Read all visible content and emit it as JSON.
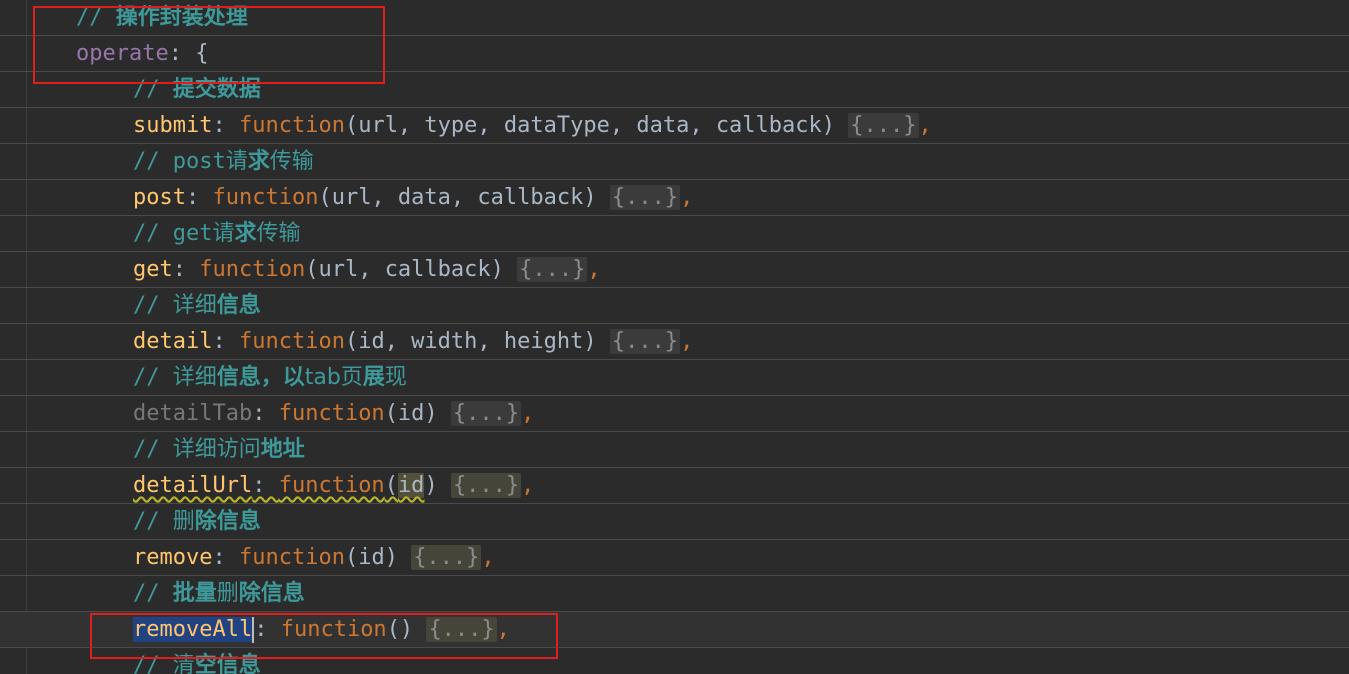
{
  "lines": [
    {
      "comment_slashes": "//",
      "comment_text": "操作封装处理"
    },
    {
      "prop": "operate",
      "rest": ": {"
    },
    {
      "comment_slashes": "//",
      "comment_text": "提交数据"
    },
    {
      "prop": "submit",
      "kw": "function",
      "params": "(url, type, dataType, data, callback)",
      "fold": "{...}"
    },
    {
      "comment_slashes": "//",
      "comment_text_a": "post",
      "comment_text_b": "请",
      "comment_text_c": "求",
      "comment_text_d": "传输"
    },
    {
      "prop": "post",
      "kw": "function",
      "params": "(url, data, callback)",
      "fold": "{...}"
    },
    {
      "comment_slashes": "//",
      "comment_text_a": "get",
      "comment_text_b": "请",
      "comment_text_c": "求",
      "comment_text_d": "传输"
    },
    {
      "prop": "get",
      "kw": "function",
      "params": "(url, callback)",
      "fold": "{...}"
    },
    {
      "comment_slashes": "//",
      "comment_text_a": "详细",
      "comment_text_b": "信息"
    },
    {
      "prop": "detail",
      "kw": "function",
      "params": "(id, width, height)",
      "fold": "{...}"
    },
    {
      "comment_slashes": "//",
      "comment_text_a": "详细",
      "comment_text_b": "信息，以",
      "comment_text_c": "tab页",
      "comment_text_d": "展",
      "comment_text_e": "现"
    },
    {
      "prop": "detailTab",
      "kw": "function",
      "params": "(id)",
      "fold": "{...}"
    },
    {
      "comment_slashes": "//",
      "comment_text_a": "详细访问",
      "comment_text_b": "地址"
    },
    {
      "prop": "detailUrl",
      "kw": "function",
      "param_id": "id",
      "fold": "{...}"
    },
    {
      "comment_slashes": "//",
      "comment_text_a": "删",
      "comment_text_b": "除信息"
    },
    {
      "prop": "remove",
      "kw": "function",
      "params": "(id)",
      "fold": "{...}"
    },
    {
      "comment_slashes": "//",
      "comment_text_a": "批量",
      "comment_text_b": "删",
      "comment_text_c": "除信息"
    },
    {
      "prop": "removeAll",
      "kw": "function",
      "params": "()",
      "fold": "{...}"
    },
    {
      "comment_slashes": "//",
      "comment_text_a": "清",
      "comment_text_b": "空信息"
    }
  ],
  "colors": {
    "background": "#2b2b2b",
    "highlight_box": "#e01e1e",
    "selection": "#214283"
  }
}
